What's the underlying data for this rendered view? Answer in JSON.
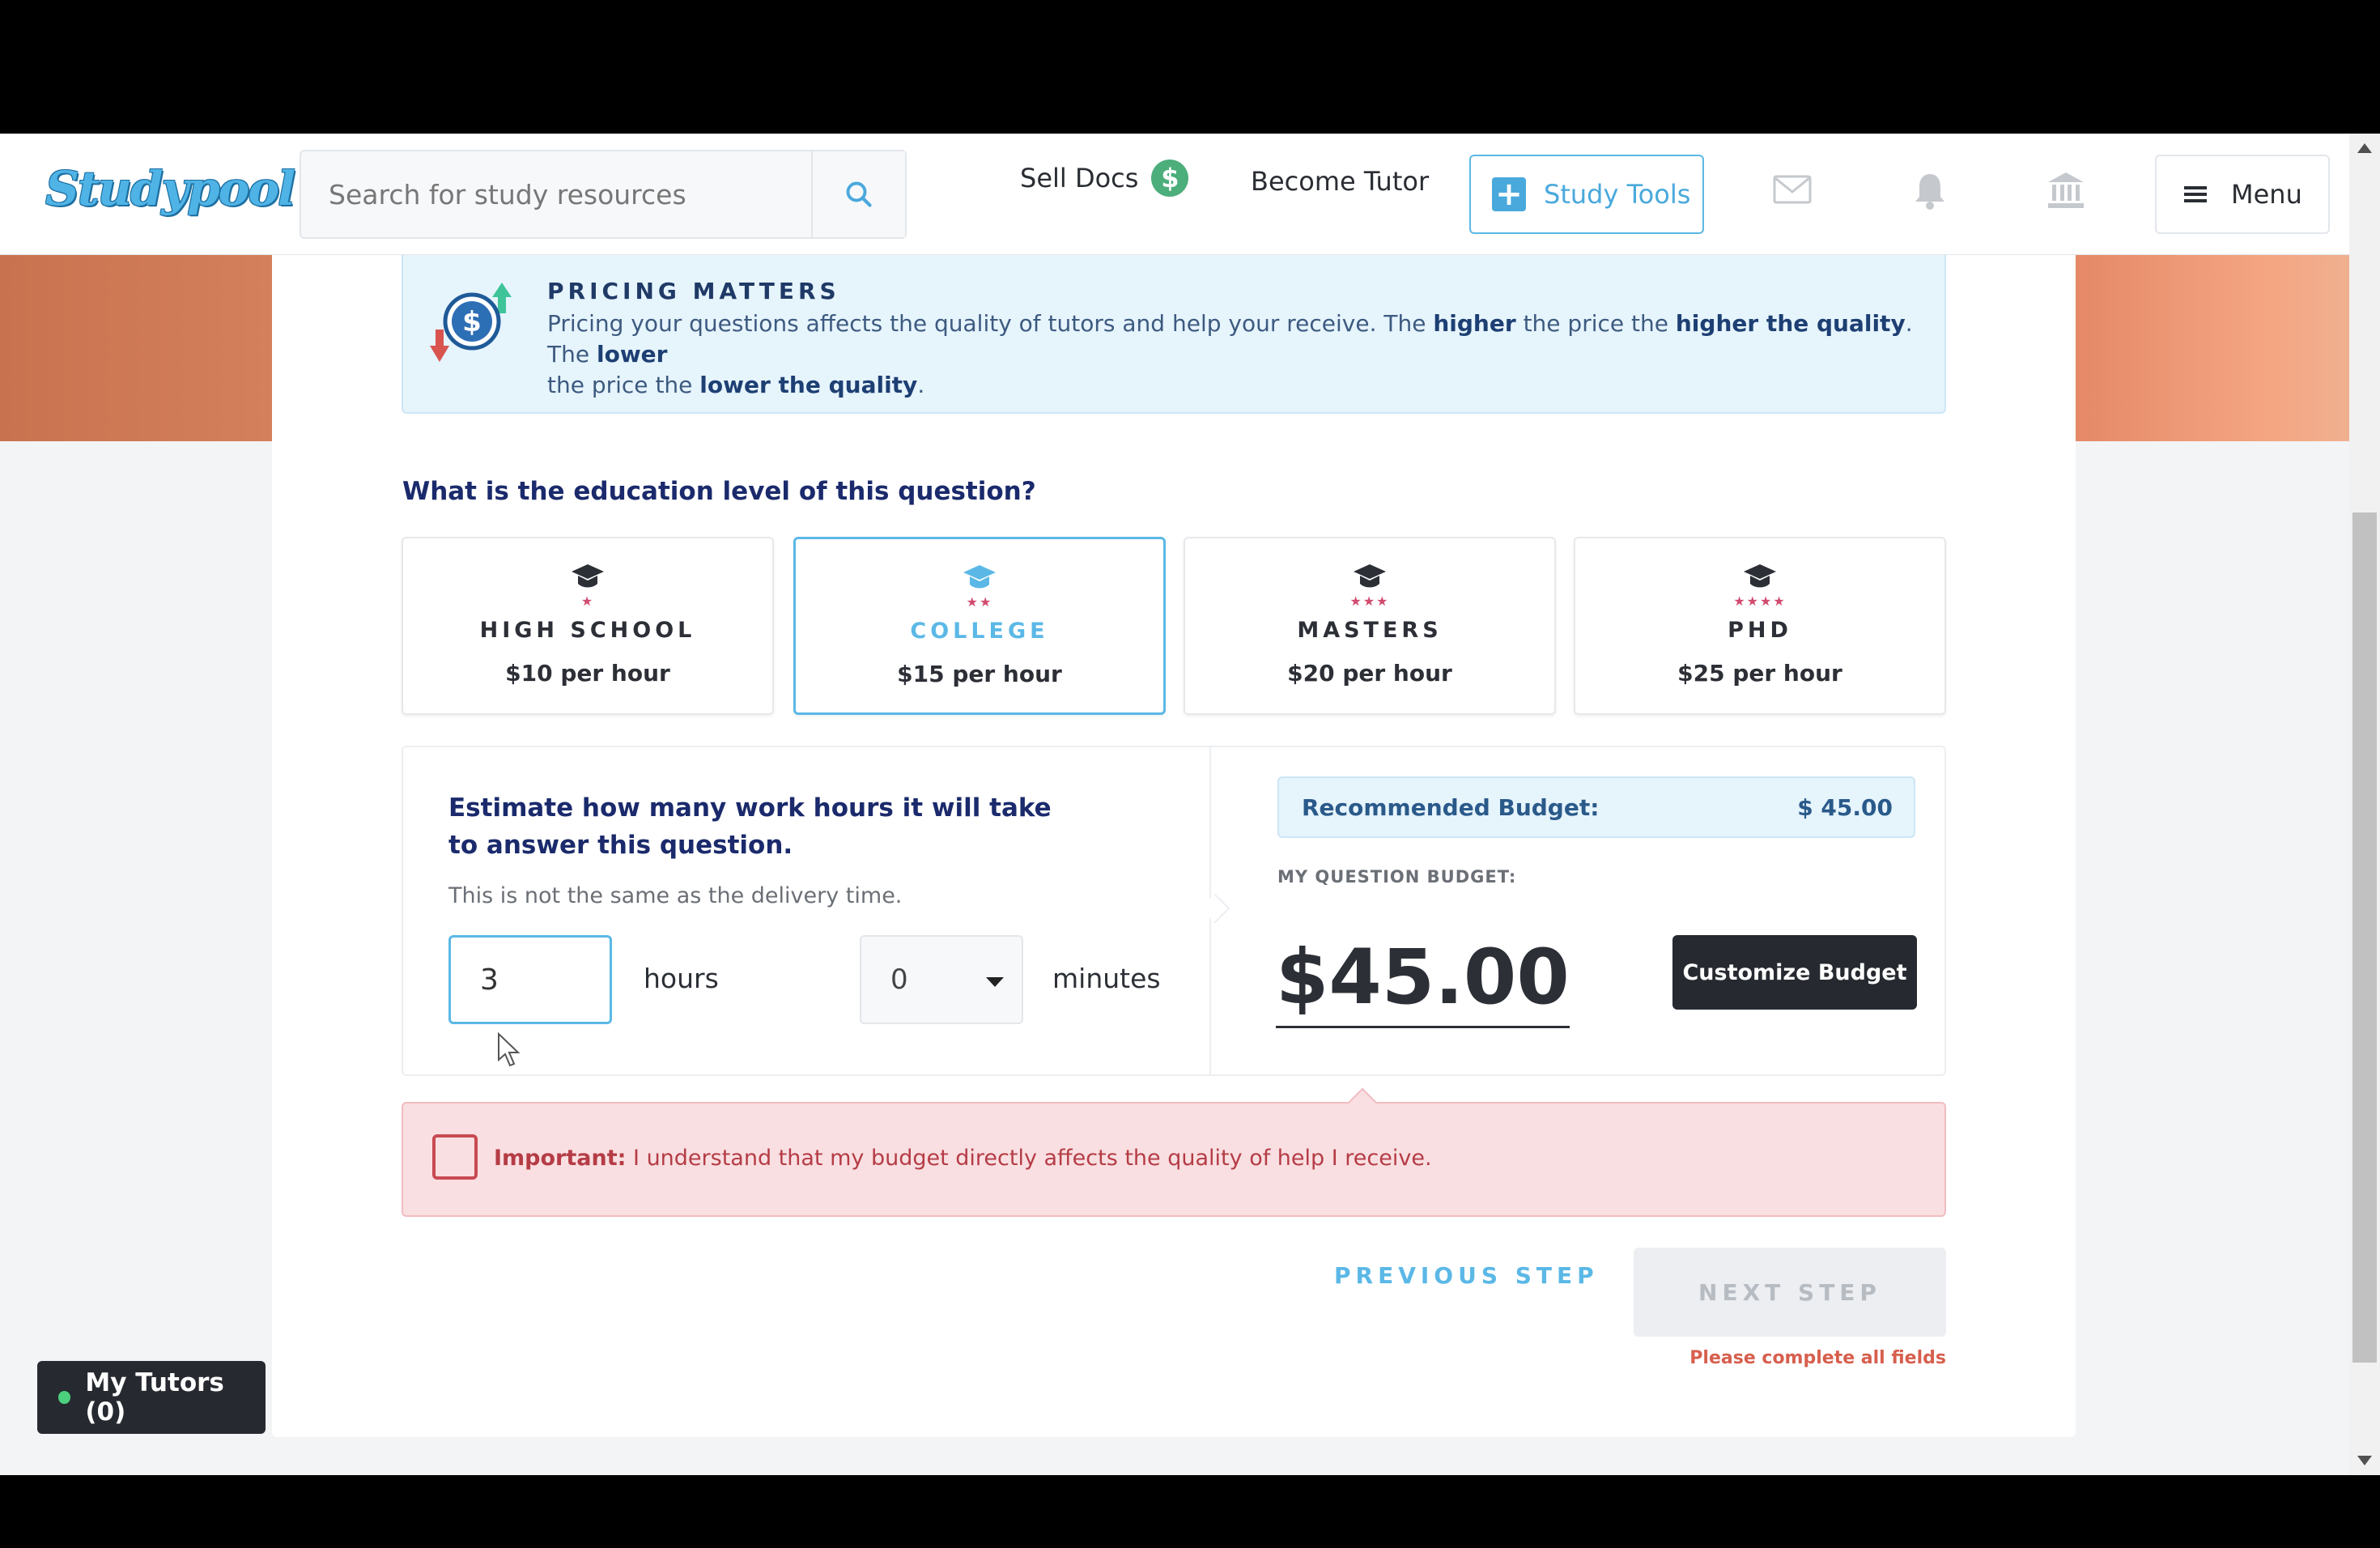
{
  "header": {
    "logo_text": "Studypool",
    "search_placeholder": "Search for study resources",
    "sell_docs": "Sell Docs",
    "sell_docs_badge": "$",
    "become_tutor": "Become Tutor",
    "study_tools": "Study Tools",
    "menu": "Menu",
    "icons": [
      "search-icon",
      "mail-icon",
      "bell-icon",
      "bank-icon",
      "hamburger-icon"
    ]
  },
  "pricing": {
    "title": "PRICING MATTERS",
    "text_1": "Pricing your questions affects the quality of tutors and help your receive. The ",
    "higher": "higher",
    "text_2": " the price the ",
    "higher_quality": "higher the quality",
    "text_3": ". The ",
    "lower": "lower",
    "text_4": " the price the ",
    "lower_quality": "lower the quality",
    "text_5": "."
  },
  "education": {
    "question": "What is the education level of this question?",
    "selected": "COLLEGE",
    "levels": [
      {
        "name": "HIGH SCHOOL",
        "stars": "★",
        "price": "$10 per hour"
      },
      {
        "name": "COLLEGE",
        "stars": "★★",
        "price": "$15 per hour"
      },
      {
        "name": "MASTERS",
        "stars": "★★★",
        "price": "$20 per hour"
      },
      {
        "name": "PHD",
        "stars": "★★★★",
        "price": "$25 per hour"
      }
    ]
  },
  "estimate": {
    "question": "Estimate how many work hours it will take to answer this question.",
    "subtext": "This is not the same as the delivery time.",
    "hours_value": "3",
    "hours_label": "hours",
    "minutes_value": "0",
    "minutes_label": "minutes"
  },
  "budget": {
    "recommended_label": "Recommended Budget:",
    "recommended_value": "$ 45.00",
    "my_label": "MY QUESTION BUDGET:",
    "my_value": "$45.00",
    "customize": "Customize Budget"
  },
  "important": {
    "label": "Important:",
    "text": " I understand that my budget directly affects the quality of help I receive."
  },
  "nav": {
    "previous": "PREVIOUS STEP",
    "next": "NEXT STEP",
    "incomplete": "Please complete all fields"
  },
  "tutors": {
    "label": "My Tutors (0)"
  },
  "colors": {
    "accent": "#5bb8e6",
    "dark": "#262a30",
    "danger": "#b53c46",
    "success": "#4cae7b"
  }
}
